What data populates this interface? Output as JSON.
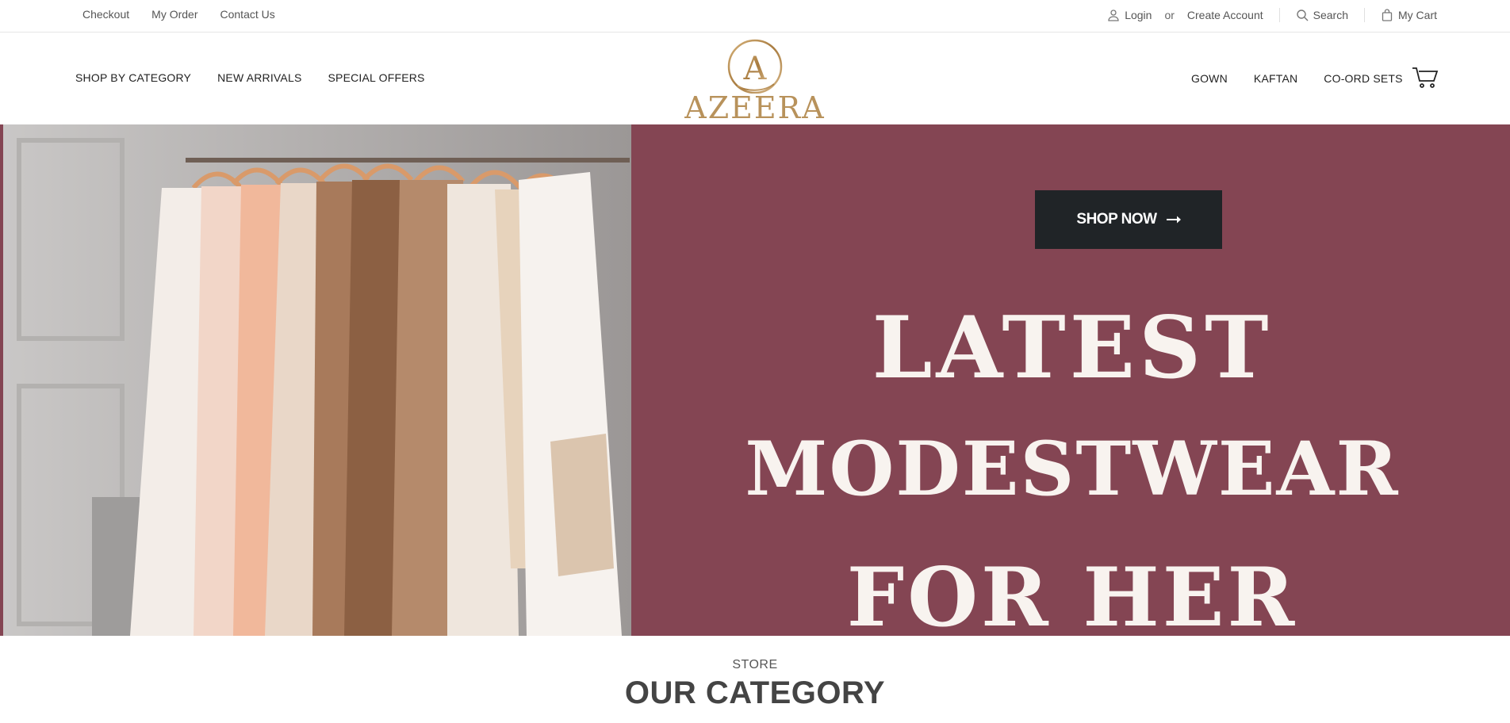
{
  "topbar": {
    "links": [
      "Checkout",
      "My Order",
      "Contact Us"
    ],
    "login": "Login",
    "or": "or",
    "create_account": "Create Account",
    "search": "Search",
    "cart": "My Cart"
  },
  "nav": {
    "left": [
      "SHOP BY CATEGORY",
      "NEW ARRIVALS",
      "SPECIAL OFFERS"
    ],
    "right": [
      "GOWN",
      "KAFTAN",
      "CO-ORD SETS"
    ]
  },
  "logo": {
    "monogram": "A",
    "wordmark": "AZEERA"
  },
  "hero": {
    "cta": "SHOP NOW",
    "line1": "LATEST",
    "line2": "MODESTWEAR",
    "line3": "FOR HER",
    "background": "#844553"
  },
  "section": {
    "eyebrow": "STORE",
    "title": "OUR CATEGORY"
  },
  "colors": {
    "accent_gold": "#b8925b",
    "button_dark": "#202427"
  }
}
